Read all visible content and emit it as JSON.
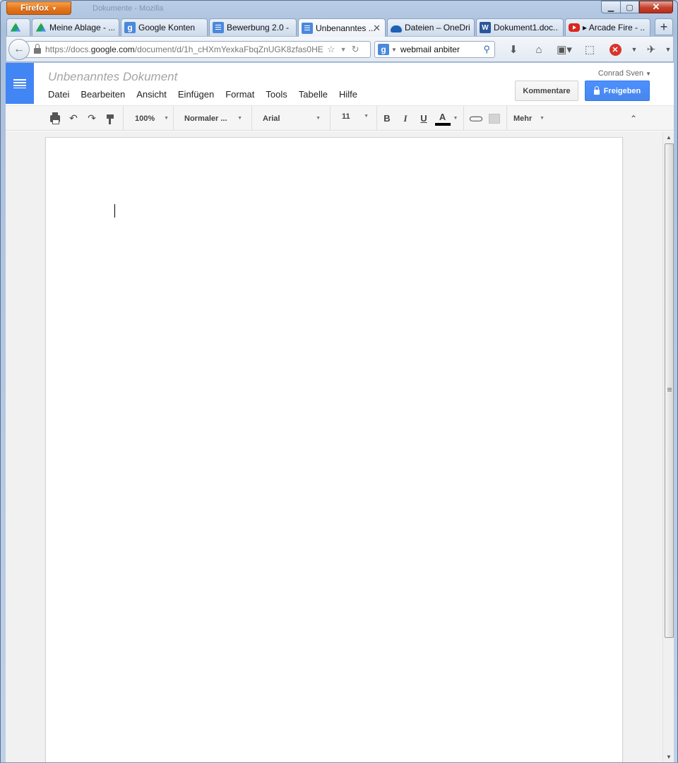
{
  "window": {
    "app_button": "Firefox",
    "title": "Dokumente - Mozilla"
  },
  "tabs": [
    {
      "label": "",
      "icon": "google-drive-icon"
    },
    {
      "label": "Meine Ablage - ...",
      "icon": "google-drive-icon"
    },
    {
      "label": "Google Konten",
      "icon": "google-icon"
    },
    {
      "label": "Bewerbung 2.0 - ...",
      "icon": "google-docs-icon"
    },
    {
      "label": "Unbenanntes ...",
      "icon": "google-docs-icon",
      "active": true
    },
    {
      "label": "Dateien – OneDri...",
      "icon": "onedrive-icon"
    },
    {
      "label": "Dokument1.doc...",
      "icon": "word-icon"
    },
    {
      "label": "▸ Arcade Fire - ...",
      "icon": "youtube-icon"
    }
  ],
  "nav": {
    "url_prefix": "https://docs.",
    "url_domain": "google.com",
    "url_path": "/document/d/1h_cHXmYexkaFbqZnUGK8zfas0HE",
    "search_engine_icon": "google-icon",
    "search_value": "webmail anbiter"
  },
  "docs": {
    "title": "Unbenanntes Dokument",
    "account": "Conrad Sven",
    "menu": [
      "Datei",
      "Bearbeiten",
      "Ansicht",
      "Einfügen",
      "Format",
      "Tools",
      "Tabelle",
      "Hilfe"
    ],
    "comments_button": "Kommentare",
    "share_button": "Freigeben",
    "toolbar": {
      "zoom": "100%",
      "style": "Normaler ...",
      "font": "Arial",
      "size": "11",
      "bold": "B",
      "italic": "I",
      "underline": "U",
      "text_color": "A",
      "more": "Mehr"
    }
  },
  "colors": {
    "docs_blue": "#4285f4",
    "share_blue": "#4d90fe",
    "firefox_orange": "#e5741a"
  }
}
